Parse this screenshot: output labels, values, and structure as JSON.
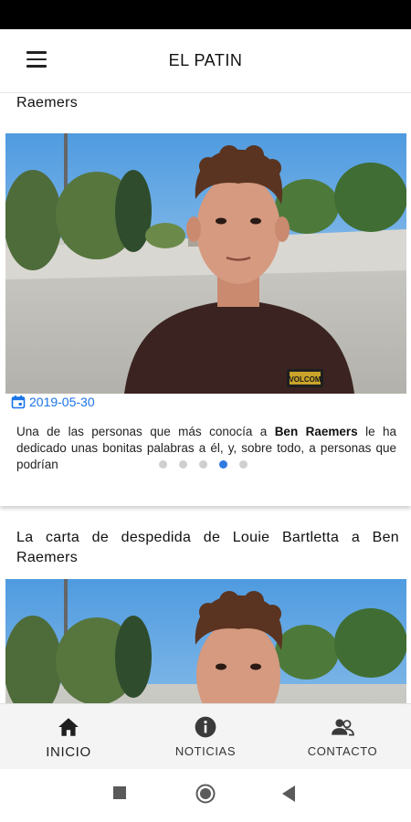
{
  "app": {
    "title": "EL PATIN"
  },
  "feed": {
    "cards": [
      {
        "title": "La carta de despedida de Louie Bartletta a Ben Raemers",
        "date": "2019-05-30",
        "excerpt_before": "Una de las personas que más conocía a ",
        "excerpt_bold": "Ben Raemers",
        "excerpt_after": " le ha dedicado unas bonitas palabras a él, y, sobre todo, a personas que podrían",
        "image_badge": "VOLCOM",
        "carousel": {
          "total": 5,
          "active_index": 3
        }
      },
      {
        "title": "La carta de despedida de Louie Bartletta a Ben Raemers"
      }
    ]
  },
  "bottom_nav": {
    "items": [
      {
        "label": "INICIO",
        "icon": "home-icon",
        "active": true
      },
      {
        "label": "NOTICIAS",
        "icon": "info-icon",
        "active": false
      },
      {
        "label": "CONTACTO",
        "icon": "contacts-icon",
        "active": false
      }
    ]
  },
  "colors": {
    "accent": "#1a73e8",
    "dot_active": "#2f7be0",
    "dot_inactive": "#cfcfcf"
  }
}
